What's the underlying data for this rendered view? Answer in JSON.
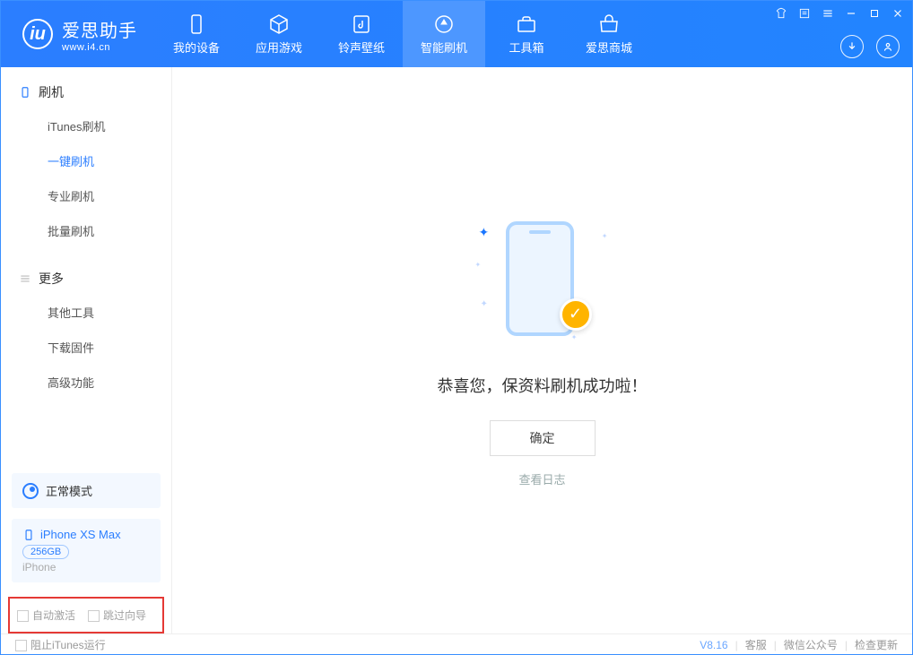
{
  "app": {
    "name": "爱思助手",
    "url": "www.i4.cn"
  },
  "tabs": [
    {
      "label": "我的设备",
      "icon": "phone"
    },
    {
      "label": "应用游戏",
      "icon": "cube"
    },
    {
      "label": "铃声壁纸",
      "icon": "music"
    },
    {
      "label": "智能刷机",
      "icon": "refresh"
    },
    {
      "label": "工具箱",
      "icon": "toolbox"
    },
    {
      "label": "爱思商城",
      "icon": "shop"
    }
  ],
  "sidebar": {
    "section1": {
      "title": "刷机",
      "items": [
        "iTunes刷机",
        "一键刷机",
        "专业刷机",
        "批量刷机"
      ]
    },
    "section2": {
      "title": "更多",
      "items": [
        "其他工具",
        "下载固件",
        "高级功能"
      ]
    }
  },
  "mode": {
    "label": "正常模式"
  },
  "device": {
    "name": "iPhone XS Max",
    "capacity": "256GB",
    "type": "iPhone"
  },
  "options": {
    "auto_activate": "自动激活",
    "skip_guide": "跳过向导"
  },
  "main": {
    "success_text": "恭喜您，保资料刷机成功啦！",
    "ok_button": "确定",
    "view_log": "查看日志"
  },
  "footer": {
    "block_itunes": "阻止iTunes运行",
    "version": "V8.16",
    "support": "客服",
    "wechat": "微信公众号",
    "update": "检查更新"
  }
}
